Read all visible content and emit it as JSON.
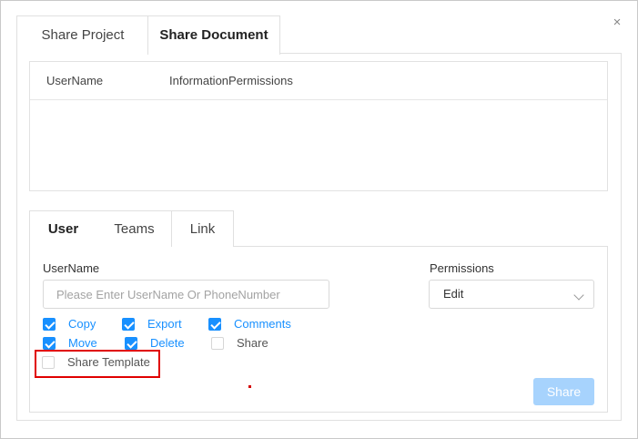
{
  "dialog": {
    "tabs": [
      {
        "label": "Share Project"
      },
      {
        "label": "Share Document"
      }
    ],
    "close_glyph": "×"
  },
  "share_table": {
    "columns": [
      "UserName",
      "InformationPermissions"
    ],
    "rows": []
  },
  "sub_tabs": [
    {
      "label": "User"
    },
    {
      "label": "Teams"
    },
    {
      "label": "Link"
    }
  ],
  "form": {
    "username_label": "UserName",
    "username_placeholder": "Please Enter UserName Or PhoneNumber",
    "permissions_label": "Permissions",
    "permissions_value": "Edit"
  },
  "checkboxes": [
    {
      "label": "Copy",
      "checked": true
    },
    {
      "label": "Export",
      "checked": true
    },
    {
      "label": "Comments",
      "checked": true
    },
    {
      "label": "Move",
      "checked": true
    },
    {
      "label": "Delete",
      "checked": true
    },
    {
      "label": "Share",
      "checked": false
    },
    {
      "label": "Share Template",
      "checked": false
    }
  ],
  "share_button": "Share",
  "colors": {
    "accent": "#1890ff",
    "button_disabled": "#a7d3fd",
    "highlight": "#e00000"
  }
}
